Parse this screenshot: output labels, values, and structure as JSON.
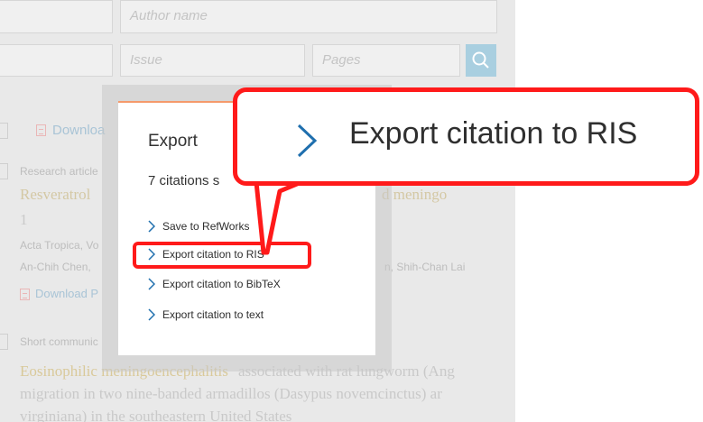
{
  "search_form": {
    "author_placeholder": "Author name",
    "issue_placeholder": "Issue",
    "pages_placeholder": "Pages",
    "search_icon": "search-icon"
  },
  "results": {
    "download_label_1": "Downloa",
    "article1_type": "Research article",
    "article1_title_part1": "Resveratrol",
    "article1_title_part2": "d meningo",
    "article1_line2": "1",
    "article1_journal": "Acta Tropica, Vo",
    "article1_authors_start": "An-Chih Chen,",
    "article1_authors_end": "n, Shih-Chan Lai",
    "download_label_2": "Download P",
    "article2_type": "Short communic",
    "article2_title_line1_start": "Eosinophilic meningoencephalitis",
    "article2_title_line1_end": "associated with rat lungworm (Ang",
    "article2_title_line2": "migration in two nine-banded armadillos (Dasypus novemcinctus) ar",
    "article2_title_line3": "virginiana) in the southeastern United States"
  },
  "export_panel": {
    "title": "Export",
    "subtitle": "7 citations s",
    "items": [
      {
        "label": "Save to RefWorks"
      },
      {
        "label": "Export citation to RIS"
      },
      {
        "label": "Export citation to BibTeX"
      },
      {
        "label": "Export citation to text"
      }
    ]
  },
  "callout": {
    "label": "Export citation to RIS"
  },
  "colors": {
    "accent_orange": "#f59a6b",
    "highlight_red": "#ff1a1a",
    "link_blue": "#1f6fae",
    "search_blue": "#a9cfe0"
  }
}
